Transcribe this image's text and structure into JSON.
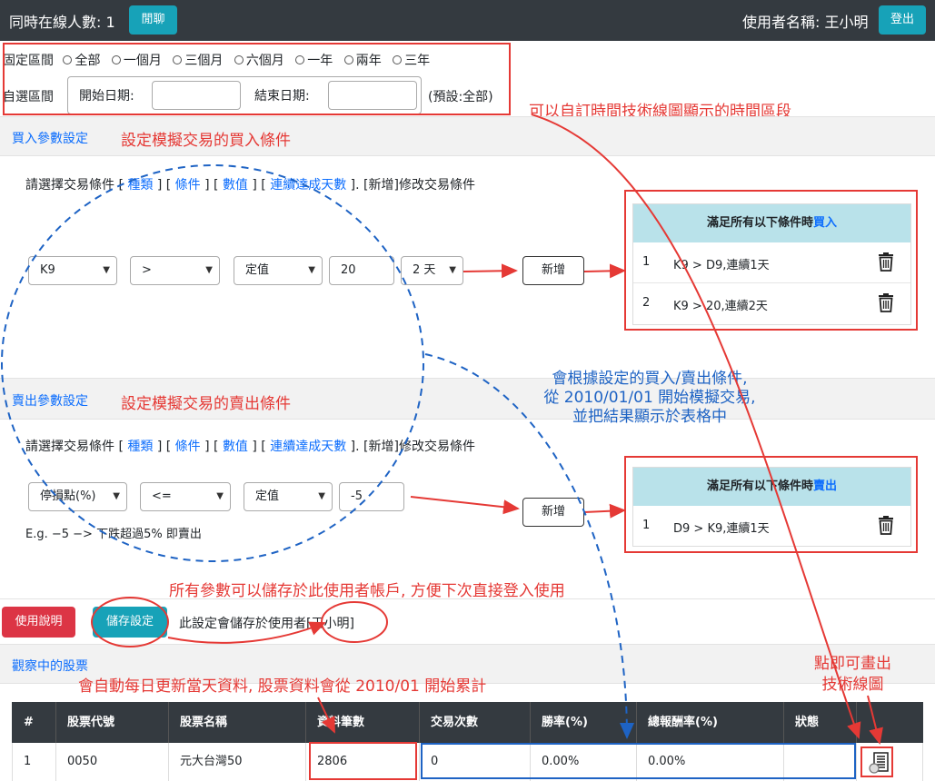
{
  "topbar": {
    "online_label": "同時在線人數: 1",
    "chat_button": "閒聊",
    "user_label": "使用者名稱: 王小明",
    "logout_button": "登出"
  },
  "range": {
    "fixed_label": "固定區間",
    "options": [
      "全部",
      "一個月",
      "三個月",
      "六個月",
      "一年",
      "兩年",
      "三年"
    ],
    "custom_label": "自選區間",
    "start_label": "開始日期:",
    "start_value": "",
    "end_label": "結束日期:",
    "end_value": "",
    "default_note": "(預設:全部)"
  },
  "notes": {
    "custom_range": "可以自訂時間技術線圖顯示的時間區段",
    "buy_params": "設定模擬交易的買入條件",
    "sell_params": "設定模擬交易的賣出條件",
    "simulate_line1": "會根據設定的買入/賣出條件,",
    "simulate_line2": "從 2010/01/01 開始模擬交易,",
    "simulate_line3": "並把結果顯示於表格中",
    "save_params": "所有參數可以儲存於此使用者帳戶, 方便下次直接登入使用",
    "auto_update": "會自動每日更新當天資料, 股票資料會從 2010/01 開始累計",
    "click_chart_line1": "點即可畫出",
    "click_chart_line2": "技術線圖"
  },
  "buy": {
    "section_title": "買入參數設定",
    "instr_prefix": "請選擇交易條件 [",
    "instr_kind": "種類",
    "instr_cond": "條件",
    "instr_value": "數值",
    "instr_days": "連續達成天數",
    "instr_suffix": "]. [新增]修改交易條件",
    "bracket_mid": "] [",
    "select_kind": "K9",
    "select_cond": ">",
    "select_value_type": "定值",
    "input_value": "20",
    "select_days": "2 天",
    "add_button": "新增",
    "panel_head_prefix": "滿足所有以下條件時",
    "panel_head_action": "買入",
    "rows": [
      {
        "n": "1",
        "text": "K9 > D9,連續1天"
      },
      {
        "n": "2",
        "text": "K9 > 20,連續2天"
      }
    ]
  },
  "sell": {
    "section_title": "賣出參數設定",
    "select_kind": "停損點(%)",
    "select_cond": "<=",
    "select_value_type": "定值",
    "input_value": "-5",
    "example": "E.g. −5 −> 下跌超過5% 即賣出",
    "add_button": "新增",
    "panel_head_prefix": "滿足所有以下條件時",
    "panel_head_action": "賣出",
    "rows": [
      {
        "n": "1",
        "text": "D9 > K9,連續1天"
      }
    ]
  },
  "actions": {
    "help_button": "使用說明",
    "save_button": "儲存設定",
    "save_note_prefix": "此設定會儲存於使用者",
    "save_note_user": "[王小明]"
  },
  "watch": {
    "section_title": "觀察中的股票",
    "headers": [
      "#",
      "股票代號",
      "股票名稱",
      "資料筆數",
      "交易次數",
      "勝率(%)",
      "總報酬率(%)",
      "狀態",
      ""
    ],
    "row": {
      "idx": "1",
      "code": "0050",
      "name": "元大台灣50",
      "count": "2806",
      "trades": "0",
      "win": "0.00%",
      "ret": "0.00%",
      "status": ""
    }
  },
  "colors": {
    "accent": "#17a2b8",
    "danger": "#dc3545",
    "annotation_red": "#e53935",
    "annotation_blue": "#1e63c4"
  },
  "icons": [
    "trash-icon",
    "chart-icon",
    "chevron-down-icon",
    "radio-icon"
  ]
}
